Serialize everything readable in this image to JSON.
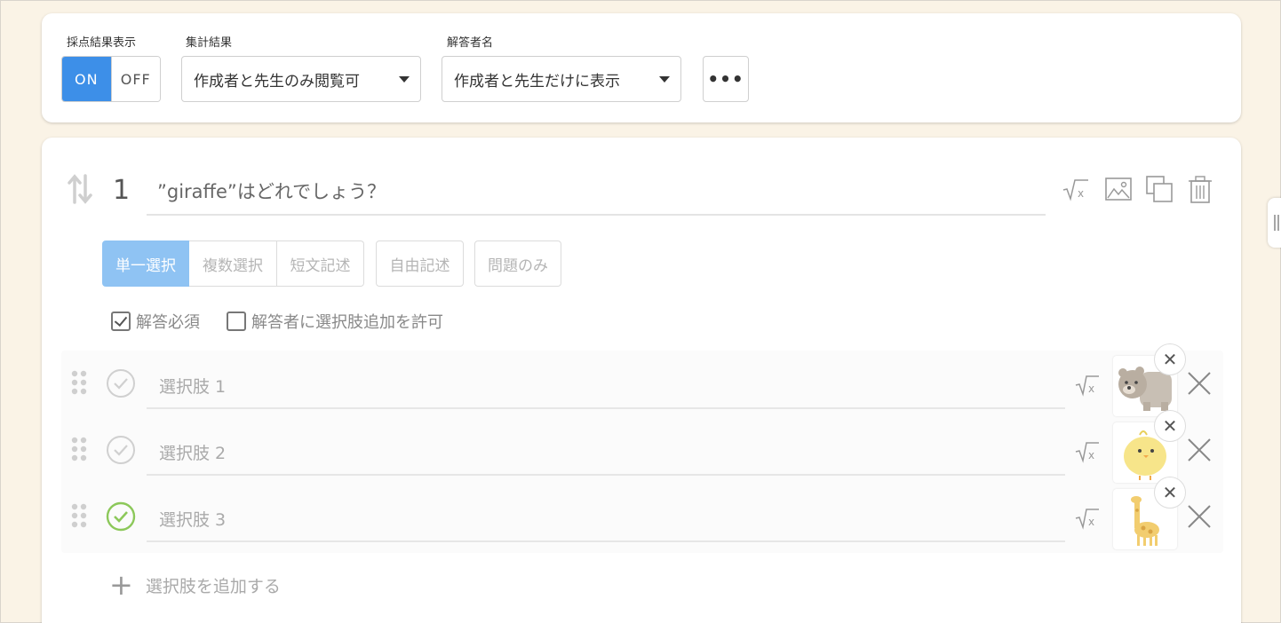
{
  "settings": {
    "score_display_label": "採点結果表示",
    "toggle_on": "ON",
    "toggle_off": "OFF",
    "aggregate_label": "集計結果",
    "aggregate_value": "作成者と先生のみ閲覧可",
    "respondent_label": "解答者名",
    "respondent_value": "作成者と先生だけに表示",
    "more_label": "•••"
  },
  "question": {
    "number": "1",
    "text": "”giraffe”はどれでしょう？",
    "types": [
      {
        "label": "単一選択",
        "active": true
      },
      {
        "label": "複数選択",
        "active": false
      },
      {
        "label": "短文記述",
        "active": false
      },
      {
        "label": "自由記述",
        "active": false
      },
      {
        "label": "問題のみ",
        "active": false
      }
    ],
    "required_label": "解答必須",
    "required_checked": true,
    "allow_add_label": "解答者に選択肢追加を許可",
    "allow_add_checked": false,
    "choices": [
      {
        "label": "選択肢 1",
        "correct": false,
        "image": "bear"
      },
      {
        "label": "選択肢 2",
        "correct": false,
        "image": "chick"
      },
      {
        "label": "選択肢 3",
        "correct": true,
        "image": "giraffe"
      }
    ],
    "add_choice_label": "選択肢を追加する"
  },
  "colors": {
    "accent": "#3d8fe8",
    "active_type": "#8fc3f3",
    "correct": "#8cc85a",
    "background": "#faf3e6"
  },
  "icons": [
    "sort-icon",
    "sqrt-icon",
    "image-icon",
    "duplicate-icon",
    "trash-icon",
    "drag-handle-icon",
    "check-circle-icon",
    "close-icon",
    "plus-icon"
  ]
}
